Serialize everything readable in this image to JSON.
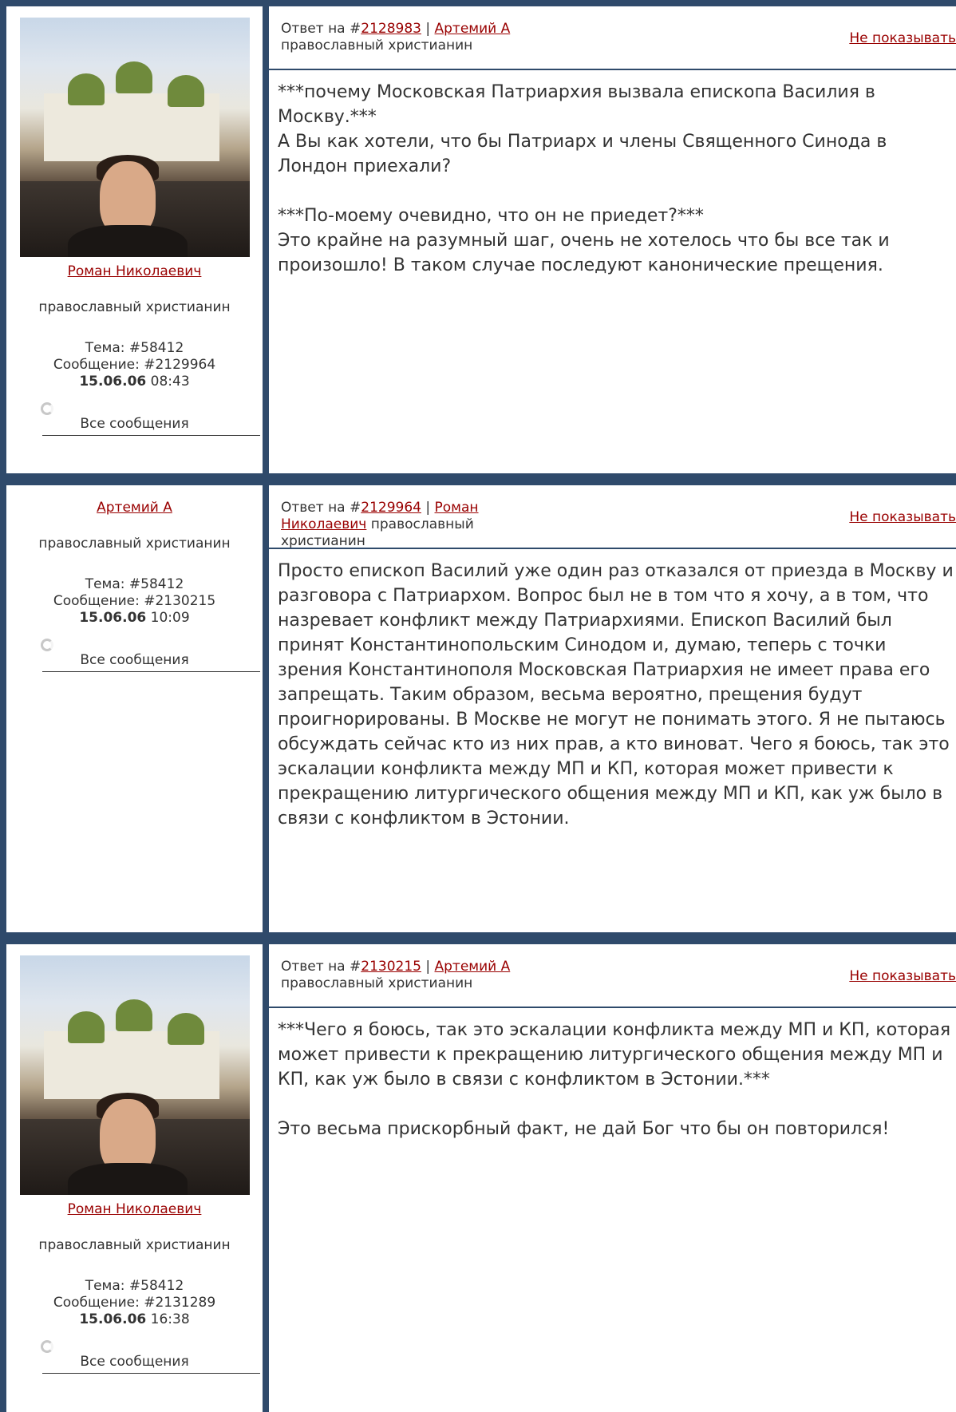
{
  "posts": [
    {
      "author": "Роман Николаевич",
      "role": "православный христианин",
      "topic": "Тема: #58412",
      "message": "Сообщение: #2129964",
      "date": "15.06.06",
      "time": "08:43",
      "all_messages": "Все сообщения",
      "reply_prefix": "Ответ на #",
      "reply_id": "2128983",
      "reply_sep": " | ",
      "reply_author": "Артемий А",
      "reply_role": "православный христианин",
      "hide": "Не показывать",
      "text": "***почему Московская Патриархия вызвала епископа Василия в Москву.***\nА Вы как хотели, что бы Патриарх и члены Священного Синода в Лондон приехали?\n\n***По-моему очевидно, что он не приедет?***\nЭто крайне на разумный шаг, очень не хотелось что бы все так и произошло! В таком случае последуют канонические прещения."
    },
    {
      "author": "Артемий А",
      "role": "православный христианин",
      "topic": "Тема: #58412",
      "message": "Сообщение: #2130215",
      "date": "15.06.06",
      "time": "10:09",
      "all_messages": "Все сообщения",
      "reply_prefix": "Ответ на #",
      "reply_id": "2129964",
      "reply_sep": " | ",
      "reply_author": "Роман Николаевич",
      "reply_role": "православный христианин",
      "hide": "Не показывать",
      "text": "Просто епископ Василий уже один раз отказался от приезда в Москву и разговора с Патриархом. Вопрос был не в том что я хочу, а в том, что назревает конфликт между Патриархиями. Епископ Василий был принят Константинопольским Синодом и, думаю, теперь с точки зрения Константинополя Московская Патриархия не имеет права его запрещать. Таким образом, весьма вероятно, прещения будут проигнорированы. В Москве не могут не понимать этого. Я не пытаюсь обсуждать сейчас кто из них прав, а кто виноват. Чего я боюсь, так это эскалации конфликта между МП и КП, которая может привести к прекращению литургического общения между МП и КП, как уж было в связи с конфликтом в Эстонии."
    },
    {
      "author": "Роман Николаевич",
      "role": "православный христианин",
      "topic": "Тема: #58412",
      "message": "Сообщение: #2131289",
      "date": "15.06.06",
      "time": "16:38",
      "all_messages": "Все сообщения",
      "reply_prefix": "Ответ на #",
      "reply_id": "2130215",
      "reply_sep": " | ",
      "reply_author": "Артемий А",
      "reply_role": "православный христианин",
      "hide": "Не показывать",
      "text": "***Чего я боюсь, так это эскалации конфликта между МП и КП, которая может привести к прекращению литургического общения между МП и КП, как уж было в связи с конфликтом в Эстонии.***\n\nЭто весьма прискорбный факт, не дай Бог что бы он повторился!"
    }
  ]
}
